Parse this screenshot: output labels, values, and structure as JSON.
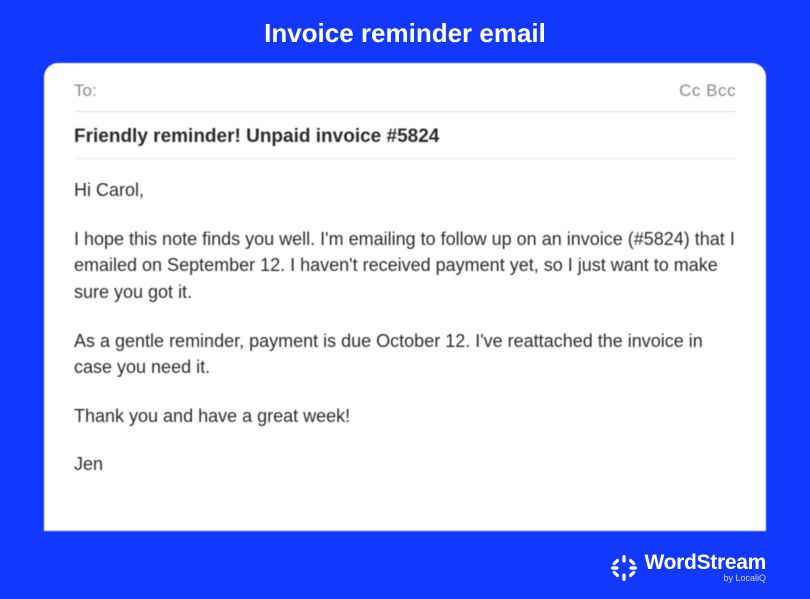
{
  "title": "Invoice reminder email",
  "email": {
    "to_label": "To:",
    "cc_bcc": "Cc Bcc",
    "subject": "Friendly reminder! Unpaid invoice #5824",
    "greeting": "Hi Carol,",
    "para1": "I hope this note finds you well. I'm emailing to follow up on an invoice (#5824) that I emailed on September 12. I haven't received  payment yet, so I just want to make sure you got it.",
    "para2": "As a gentle reminder, payment is due October 12. I've reattached the invoice in case you need it.",
    "para3": "Thank you and have a great week!",
    "signature": "Jen"
  },
  "footer": {
    "brand": "WordStream",
    "byline": "by LocaliQ"
  }
}
